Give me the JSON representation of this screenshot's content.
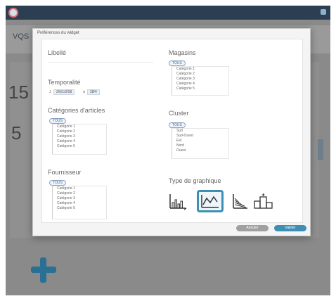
{
  "app": {
    "title_fragment": "VQS",
    "numbers": [
      "15",
      "5"
    ]
  },
  "dialog": {
    "title": "Préférences du widget",
    "libelle": {
      "label": "Libellé"
    },
    "temporalite": {
      "label": "Temporalité",
      "from_prefix": "J",
      "from_value": "2/6/1/2/08",
      "to_value": "28/4",
      "to_prefix": "à"
    },
    "categories": {
      "label": "Catégories d'articles",
      "select_all": "TOUS",
      "items": [
        "Catégorie 1",
        "Catégorie 2",
        "Catégorie 3",
        "Catégorie 4",
        "Catégorie 5"
      ]
    },
    "fournisseur": {
      "label": "Fournisseur",
      "select_all": "TOUS",
      "items": [
        "Catégorie 1",
        "Catégorie 2",
        "Catégorie 3",
        "Catégorie 4",
        "Catégorie 5"
      ]
    },
    "magasins": {
      "label": "Magasins",
      "select_all": "TOUS",
      "items": [
        "Catégorie 1",
        "Catégorie 2",
        "Catégorie 3",
        "Catégorie 4",
        "Catégorie 5"
      ]
    },
    "cluster": {
      "label": "Cluster",
      "select_all": "TOUS",
      "items": [
        "Sud",
        "Sud-Ouest",
        "Est",
        "Nord",
        "Ouest"
      ]
    },
    "chart_type": {
      "label": "Type de graphique",
      "options": [
        {
          "icon": "bar-chart-icon",
          "selected": false
        },
        {
          "icon": "line-chart-icon",
          "selected": true
        },
        {
          "icon": "area-chart-icon",
          "selected": false
        },
        {
          "icon": "podium-chart-icon",
          "selected": false
        }
      ]
    },
    "buttons": {
      "cancel": "Annuler",
      "ok": "Valider"
    }
  },
  "colors": {
    "accent": "#3d8fb4",
    "topbar": "#2c3f52",
    "overlay": "#8a8a8a"
  }
}
